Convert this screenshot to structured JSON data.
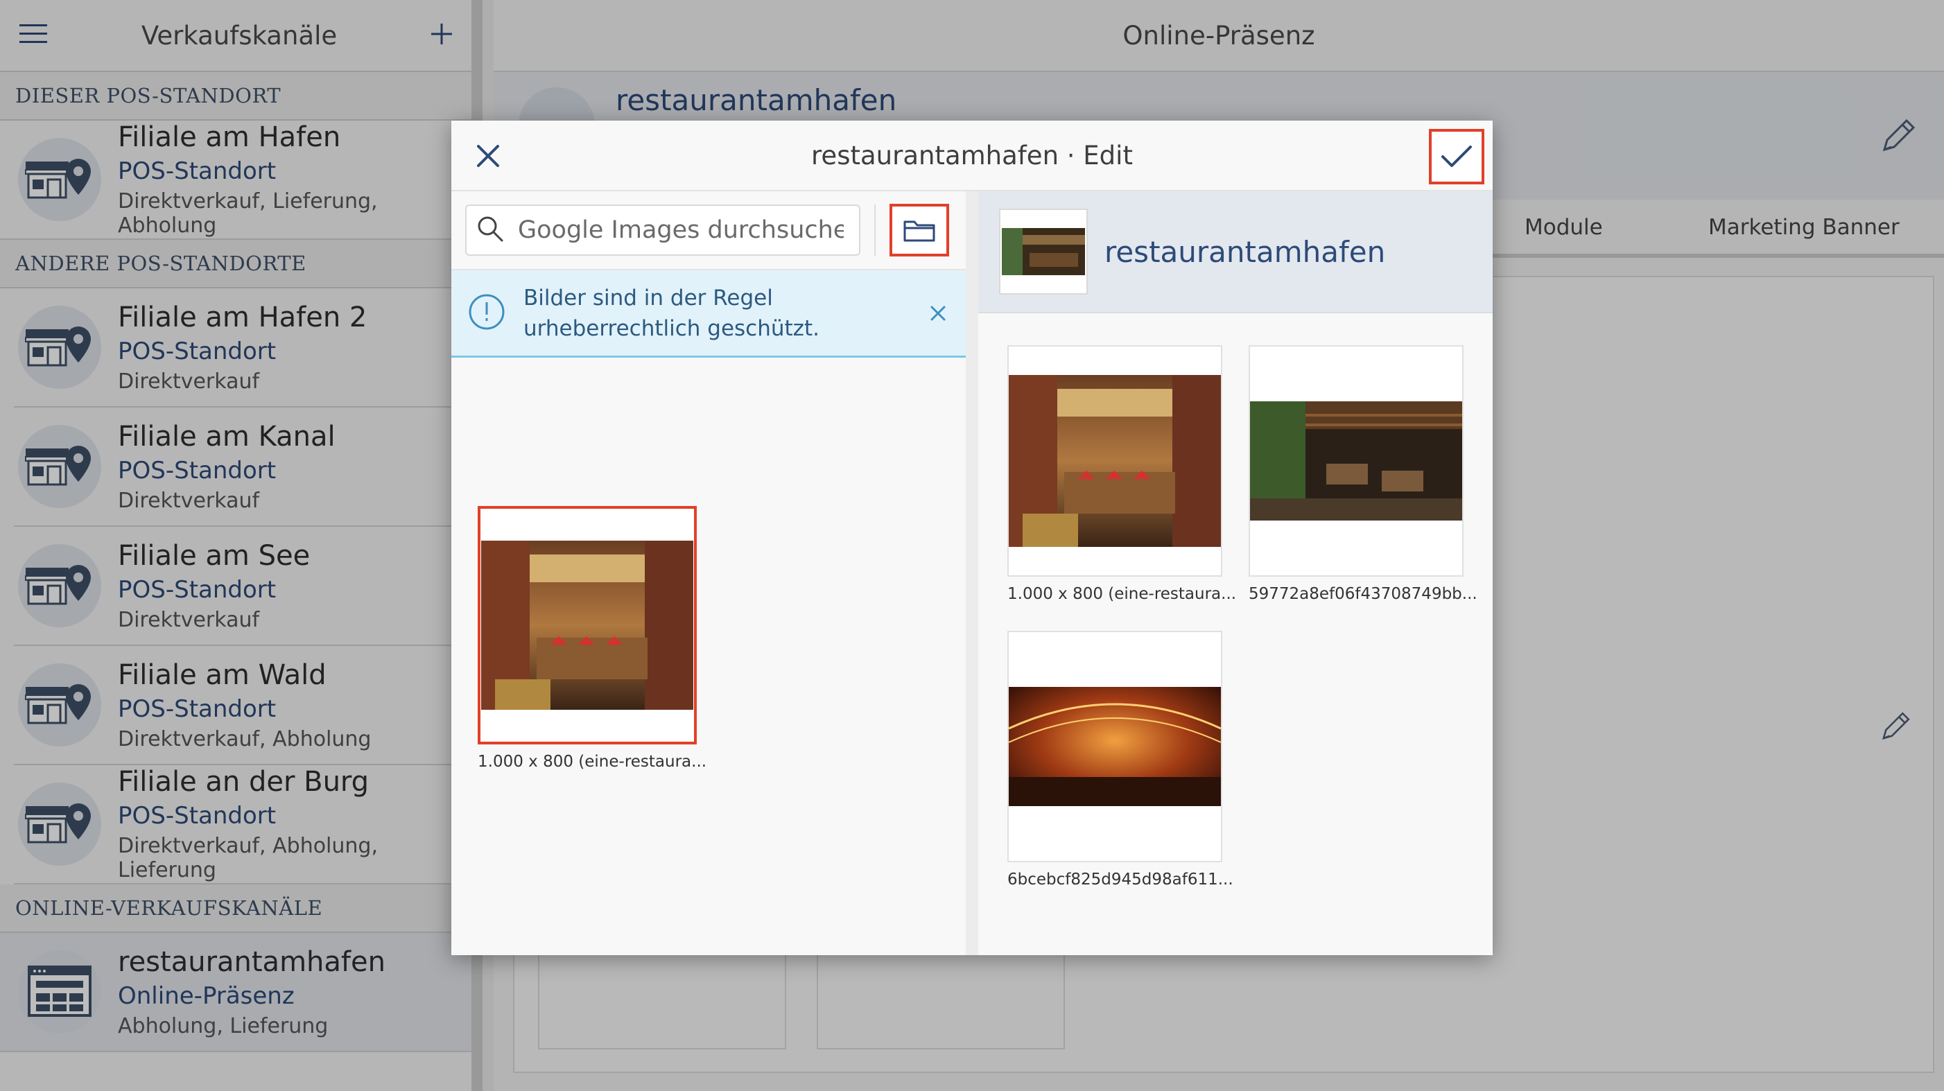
{
  "sidebar": {
    "title": "Verkaufskanäle",
    "sections": {
      "this_location": "DIESER POS-STANDORT",
      "other_locations": "ANDERE POS-STANDORTE",
      "online_channels": "ONLINE-VERKAUFSKANÄLE"
    },
    "current_store": {
      "name": "Filiale am Hafen",
      "type": "POS-Standort",
      "modes": "Direktverkauf, Lieferung, Abholung"
    },
    "other_stores": [
      {
        "name": "Filiale am Hafen 2",
        "type": "POS-Standort",
        "modes": "Direktverkauf"
      },
      {
        "name": "Filiale am Kanal",
        "type": "POS-Standort",
        "modes": "Direktverkauf"
      },
      {
        "name": "Filiale am See",
        "type": "POS-Standort",
        "modes": "Direktverkauf"
      },
      {
        "name": "Filiale am Wald",
        "type": "POS-Standort",
        "modes": "Direktverkauf, Abholung"
      },
      {
        "name": "Filiale an der Burg",
        "type": "POS-Standort",
        "modes": "Direktverkauf, Abholung, Lieferung"
      }
    ],
    "online_store": {
      "name": "restaurantamhafen",
      "type": "Online-Präsenz",
      "modes": "Abholung, Lieferung"
    }
  },
  "main": {
    "title": "Online-Präsenz",
    "profile_name": "restaurantamhafen",
    "tabs": [
      "Module",
      "Marketing Banner"
    ]
  },
  "modal": {
    "title": "restaurantamhafen · Edit",
    "search_placeholder": "Google Images durchsuchen ...",
    "notice": "Bilder sind in der Regel urheberrechtlich geschützt.",
    "results": [
      {
        "caption": "1.000 x 800 (eine-restaura..."
      }
    ],
    "selected_title": "restaurantamhafen",
    "gallery": [
      {
        "caption": "1.000 x 800 (eine-restaura..."
      },
      {
        "caption": "59772a8ef06f43708749bb..."
      },
      {
        "caption": "6bcebcf825d945d98af611..."
      }
    ]
  },
  "colors": {
    "accent_blue": "#2d4a78",
    "highlight_red": "#e0402a",
    "info_blue": "#7bc6e8"
  },
  "icons": [
    "menu-icon",
    "plus-icon",
    "store-location-icon",
    "web-page-icon",
    "pencil-icon",
    "close-icon",
    "check-icon",
    "search-icon",
    "folder-icon",
    "info-icon"
  ]
}
